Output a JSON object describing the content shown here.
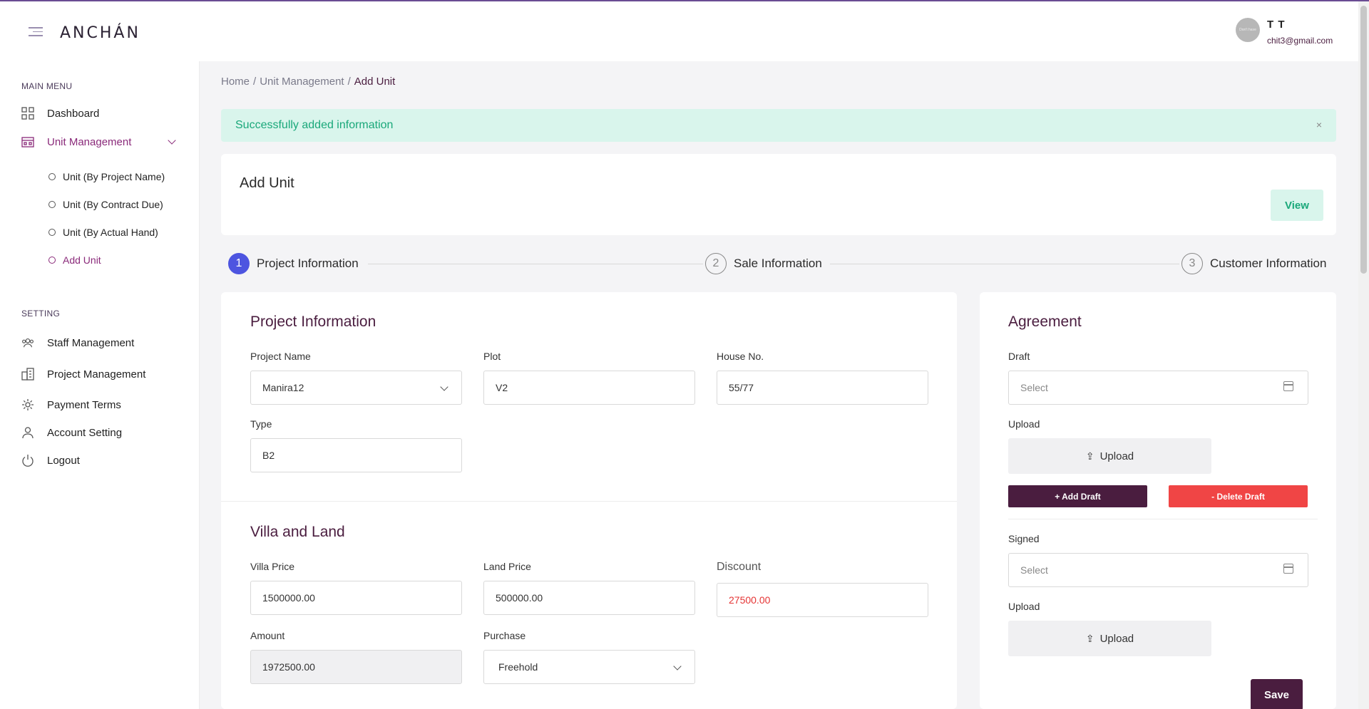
{
  "header": {
    "logo": "ANCHÁN",
    "avatar_text": "Don't have",
    "user_name": "T T",
    "user_email": "chit3@gmail.com"
  },
  "sidebar": {
    "main_menu_label": "MAIN MENU",
    "dashboard": "Dashboard",
    "unit_management": "Unit Management",
    "sub_items": [
      "Unit (By Project Name)",
      "Unit (By Contract Due)",
      "Unit (By Actual Hand)",
      "Add Unit"
    ],
    "setting_label": "SETTING",
    "staff_management": "Staff Management",
    "project_management": "Project Management",
    "payment_terms": "Payment Terms",
    "account_setting": "Account Setting",
    "logout": "Logout"
  },
  "breadcrumb": {
    "home": "Home",
    "sep": "/",
    "unit_management": "Unit Management",
    "current": "Add Unit"
  },
  "alert": {
    "message": "Successfully added information",
    "close": "×"
  },
  "page": {
    "title": "Add Unit",
    "view_button": "View"
  },
  "steps": [
    {
      "num": "1",
      "label": "Project Information"
    },
    {
      "num": "2",
      "label": "Sale Information"
    },
    {
      "num": "3",
      "label": "Customer Information"
    }
  ],
  "project_info": {
    "title": "Project Information",
    "project_name_label": "Project Name",
    "project_name_value": "Manira12",
    "plot_label": "Plot",
    "plot_value": "V2",
    "house_label": "House No.",
    "house_value": "55/77",
    "type_label": "Type",
    "type_value": "B2"
  },
  "villa_land": {
    "title": "Villa and Land",
    "villa_price_label": "Villa Price",
    "villa_price_value": "1500000.00",
    "land_price_label": "Land Price",
    "land_price_value": "500000.00",
    "discount_label": "Discount",
    "discount_value": "27500.00",
    "amount_label": "Amount",
    "amount_value": "1972500.00",
    "purchase_label": "Purchase",
    "purchase_value": "Freehold"
  },
  "agreement": {
    "title": "Agreement",
    "draft_label": "Draft",
    "draft_placeholder": "Select",
    "upload_label": "Upload",
    "upload_button": "Upload",
    "add_draft": "+ Add Draft",
    "delete_draft": "- Delete Draft",
    "signed_label": "Signed",
    "signed_placeholder": "Select",
    "upload_label_2": "Upload",
    "upload_button_2": "Upload",
    "save": "Save"
  },
  "colors": {
    "brand": "#4a1d3f",
    "accent": "#8a2a7a",
    "success_bg": "#d9f5ec",
    "success_text": "#1aa87a",
    "danger": "#f04545",
    "step_active": "#4d55e0"
  }
}
